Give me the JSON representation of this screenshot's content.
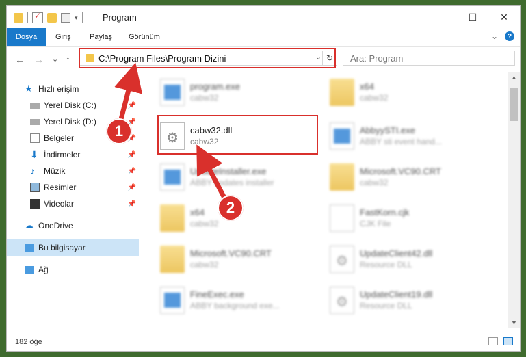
{
  "window": {
    "title": "Program"
  },
  "quick_access_icons": [
    "folder-icon",
    "checkmark-icon",
    "folder-icon",
    "properties-icon"
  ],
  "window_buttons": {
    "minimize": "—",
    "maximize": "☐",
    "close": "✕"
  },
  "ribbon": {
    "tabs": [
      "Dosya",
      "Giriş",
      "Paylaş",
      "Görünüm"
    ],
    "expand_symbol": "⌄",
    "help_symbol": "?"
  },
  "nav": {
    "back": "←",
    "forward": "→",
    "recent": "⌄",
    "up": "↑",
    "address": "C:\\Program Files\\Program Dizini",
    "address_dropdown": "⌄",
    "refresh": "↻",
    "search_placeholder": "Ara: Program"
  },
  "sidebar": {
    "items": [
      {
        "label": "Hızlı erişim",
        "icon": "star-icon",
        "pinned": false
      },
      {
        "label": "Yerel Disk (C:)",
        "icon": "drive-icon",
        "pinned": true
      },
      {
        "label": "Yerel Disk (D:)",
        "icon": "drive-icon",
        "pinned": true
      },
      {
        "label": "Belgeler",
        "icon": "documents-icon",
        "pinned": true
      },
      {
        "label": "İndirmeler",
        "icon": "download-icon",
        "pinned": true
      },
      {
        "label": "Müzik",
        "icon": "music-icon",
        "pinned": true
      },
      {
        "label": "Resimler",
        "icon": "pictures-icon",
        "pinned": true
      },
      {
        "label": "Videolar",
        "icon": "video-icon",
        "pinned": true
      },
      {
        "label": "OneDrive",
        "icon": "cloud-icon",
        "pinned": false
      },
      {
        "label": "Bu bilgisayar",
        "icon": "computer-icon",
        "pinned": false,
        "selected": true
      },
      {
        "label": "Ağ",
        "icon": "network-icon",
        "pinned": false
      }
    ],
    "pin_symbol": "📌"
  },
  "files": [
    {
      "name": "program.exe",
      "sub": "cabw32",
      "icon": "exe",
      "blurred": true
    },
    {
      "name": "x64",
      "sub": "cabw32",
      "icon": "folder",
      "blurred": true
    },
    {
      "name": "cabw32.dll",
      "sub": "cabw32",
      "icon": "dll",
      "blurred": false
    },
    {
      "name": "AbbyySTI.exe",
      "sub": "ABBY sti event hand...",
      "icon": "exe",
      "blurred": true
    },
    {
      "name": "UpdateInstaller.exe",
      "sub": "ABBY updates installer",
      "icon": "exe",
      "blurred": true
    },
    {
      "name": "Microsoft.VC90.CRT",
      "sub": "cabw32",
      "icon": "folder",
      "blurred": true
    },
    {
      "name": "x64",
      "sub": "cabw32",
      "icon": "folder",
      "blurred": true
    },
    {
      "name": "FastKorn.cjk",
      "sub": "CJK File",
      "icon": "page",
      "blurred": true
    },
    {
      "name": "Microsoft.VC90.CRT",
      "sub": "cabw32",
      "icon": "folder",
      "blurred": true
    },
    {
      "name": "UpdateClient42.dll",
      "sub": "Resource DLL",
      "icon": "dll",
      "blurred": true
    },
    {
      "name": "FineExec.exe",
      "sub": "ABBY background exe...",
      "icon": "exe",
      "blurred": true
    },
    {
      "name": "UpdateClient19.dll",
      "sub": "Resource DLL",
      "icon": "dll",
      "blurred": true
    }
  ],
  "annotations": {
    "step1": "1",
    "step2": "2",
    "highlight_color": "#d9302c"
  },
  "statusbar": {
    "count": "182 öğe"
  },
  "scrollbar": {
    "up": "▲",
    "down": "▼"
  }
}
